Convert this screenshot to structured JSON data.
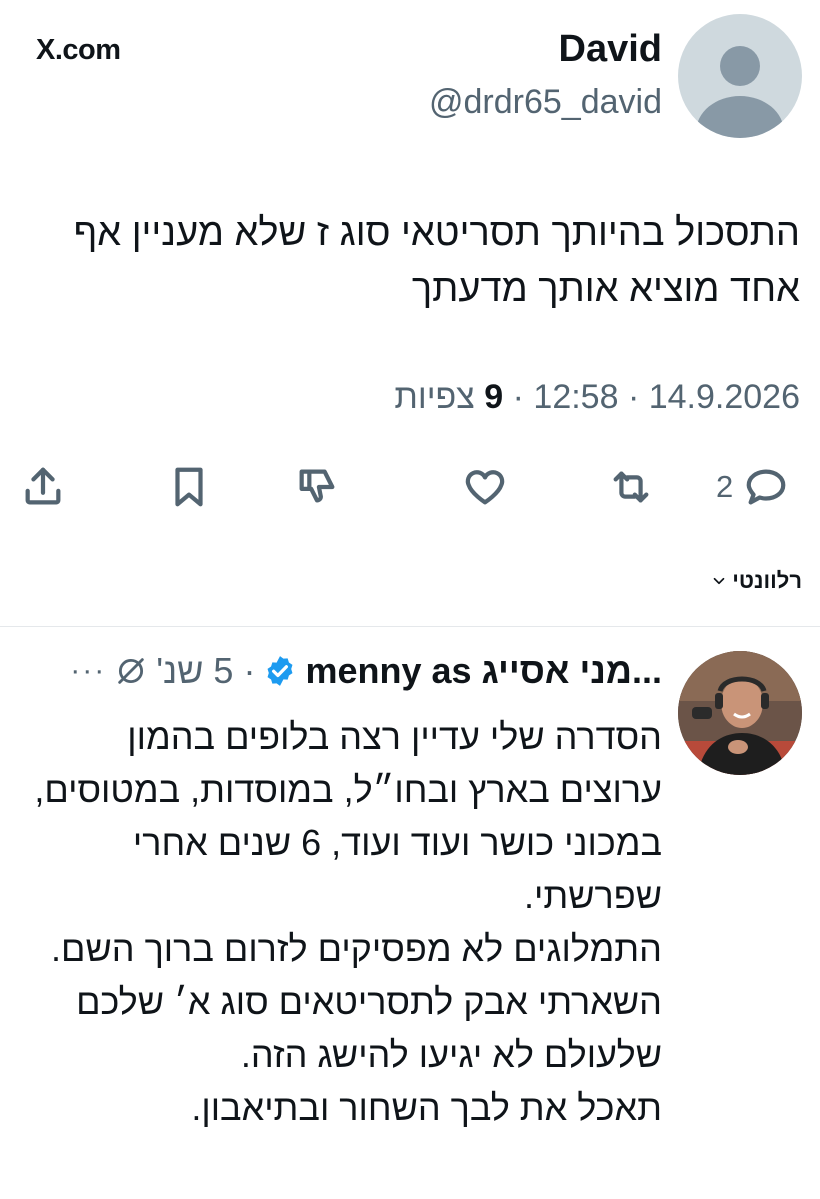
{
  "header": {
    "site": "X.com",
    "author_name": "David",
    "author_handle": "@drdr65_david"
  },
  "tweet": {
    "text": "התסכול בהיותך תסריטאי סוג ז שלא מעניין אף אחד מוציא אותך מדעתך",
    "date": "14.9.2026",
    "time": "12:58",
    "views_count": "9",
    "views_label": "צפיות"
  },
  "actions": {
    "reply_count": "2",
    "retweet_icon": "retweet-icon",
    "like_icon": "heart-icon",
    "dislike_icon": "thumbs-down-icon",
    "bookmark_icon": "bookmark-icon",
    "share_icon": "share-icon"
  },
  "sort": {
    "label": "רלוונטי"
  },
  "reply": {
    "display_name": "...מני אסייג menny as",
    "time": "5 שנ'",
    "text": "הסדרה שלי עדיין רצה בלופים בהמון ערוצים בארץ ובחו״ל, במוסדות, במטוסים, במכוני כושר ועוד ועוד, 6 שנים אחרי שפרשתי.\nהתמלוגים לא מפסיקים לזרום ברוך השם.\nהשארתי אבק לתסריטאים סוג א׳ שלכם שלעולם לא יגיעו להישג הזה.\nתאכל את לבך השחור ובתיאבון."
  },
  "colors": {
    "text": "#0f1419",
    "secondary": "#536471",
    "verified": "#1d9bf0",
    "divider": "#e5e8eb"
  }
}
